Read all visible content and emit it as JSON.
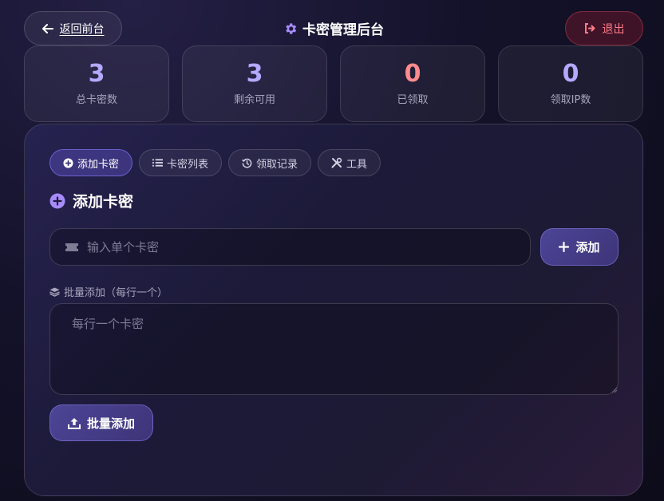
{
  "header": {
    "back_label": "返回前台",
    "title": "卡密管理后台",
    "logout_label": "退出"
  },
  "stats": [
    {
      "value": "3",
      "label": "总卡密数",
      "color": "#b4a9ff"
    },
    {
      "value": "3",
      "label": "剩余可用",
      "color": "#b4a9ff"
    },
    {
      "value": "0",
      "label": "已领取",
      "color": "#ff8c8c"
    },
    {
      "value": "0",
      "label": "领取IP数",
      "color": "#b4a9ff"
    }
  ],
  "tabs": [
    {
      "label": "添加卡密",
      "icon": "plus-circle-icon",
      "active": true
    },
    {
      "label": "卡密列表",
      "icon": "list-icon",
      "active": false
    },
    {
      "label": "领取记录",
      "icon": "history-icon",
      "active": false
    },
    {
      "label": "工具",
      "icon": "tools-icon",
      "active": false
    }
  ],
  "section": {
    "title": "添加卡密"
  },
  "single_add": {
    "placeholder": "输入单个卡密",
    "button_label": "添加"
  },
  "batch_add": {
    "label": "批量添加（每行一个）",
    "placeholder": "每行一个卡密",
    "button_label": "批量添加"
  },
  "colors": {
    "accent": "#8b7cf6",
    "danger": "#ff7b88"
  }
}
